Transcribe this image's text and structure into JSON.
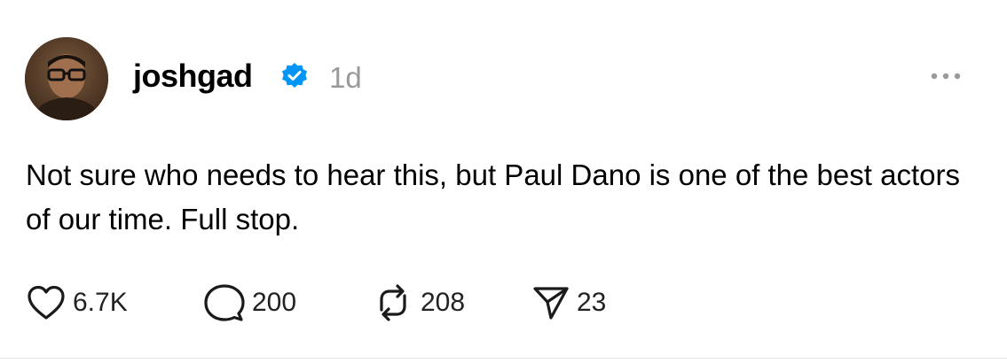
{
  "post": {
    "username": "joshgad",
    "timestamp": "1d",
    "verified": true,
    "text": "Not sure who needs to hear this, but Paul Dano is one of the best actors of our time. Full stop.",
    "more_icon": "ellipsis-icon",
    "actions": {
      "likes": "6.7K",
      "replies": "200",
      "reposts": "208",
      "shares": "23"
    }
  },
  "colors": {
    "verified_badge": "#0095f6",
    "timestamp": "#999999",
    "text": "#000000"
  }
}
